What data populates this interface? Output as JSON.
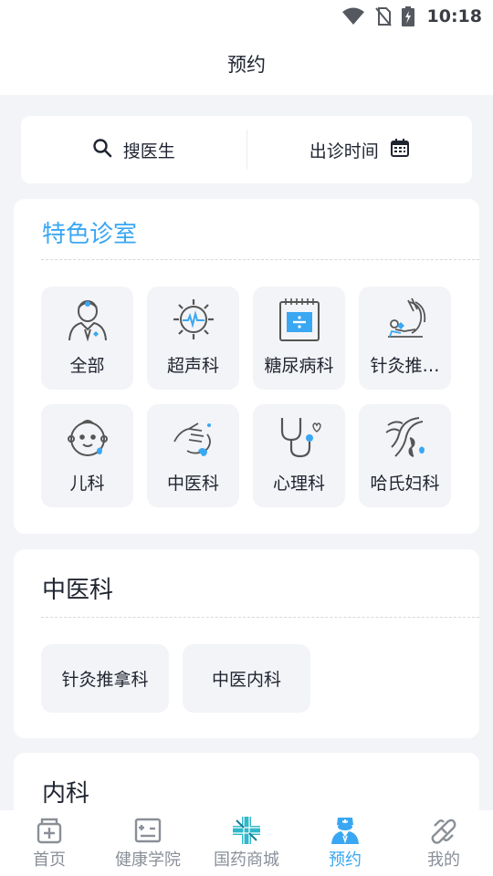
{
  "status_bar": {
    "time": "10:18",
    "icons": [
      "wifi-icon",
      "no-sim-icon",
      "battery-charging-icon"
    ]
  },
  "header": {
    "title": "预约"
  },
  "search": {
    "doctor_label": "搜医生",
    "schedule_label": "出诊时间"
  },
  "features": {
    "title": "特色诊室",
    "items": [
      {
        "label": "全部",
        "icon": "doctor-icon"
      },
      {
        "label": "超声科",
        "icon": "ultrasound-icon"
      },
      {
        "label": "糖尿病科",
        "icon": "diabetes-icon"
      },
      {
        "label": "针灸推…",
        "icon": "acupuncture-icon"
      },
      {
        "label": "儿科",
        "icon": "baby-icon"
      },
      {
        "label": "中医科",
        "icon": "pulse-diagnosis-icon"
      },
      {
        "label": "心理科",
        "icon": "stethoscope-icon"
      },
      {
        "label": "哈氏妇科",
        "icon": "woman-icon"
      }
    ]
  },
  "tcm_section": {
    "title": "中医科",
    "chips": [
      "针灸推拿科",
      "中医内科"
    ]
  },
  "internal_section": {
    "title": "内科"
  },
  "tabbar": {
    "active": "预约",
    "tabs": [
      {
        "label": "首页",
        "icon": "home-icon"
      },
      {
        "label": "健康学院",
        "icon": "health-academy-icon"
      },
      {
        "label": "国药商城",
        "icon": "pharmacy-mall-icon"
      },
      {
        "label": "预约",
        "icon": "appointment-icon"
      },
      {
        "label": "我的",
        "icon": "profile-icon"
      }
    ]
  },
  "colors": {
    "accent": "#3aa7f2",
    "background": "#f3f4f7",
    "text": "#1f2430",
    "inactive": "#8a8f98"
  }
}
